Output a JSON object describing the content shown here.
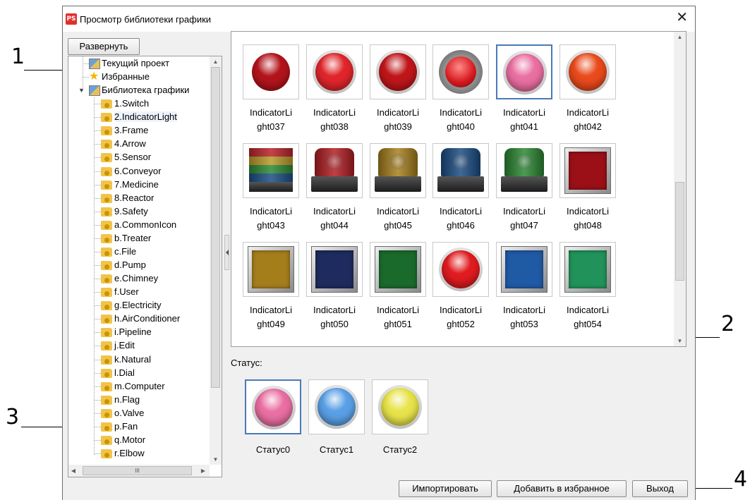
{
  "callouts": [
    "1",
    "2",
    "3",
    "4"
  ],
  "window": {
    "app_icon_text": "PS",
    "title": "Просмотр библиотеки графики",
    "close_glyph": "✕"
  },
  "toolbar": {
    "expand_label": "Развернуть"
  },
  "tree": {
    "root_items": [
      {
        "label": "Текущий проект",
        "icon": "project-icon"
      },
      {
        "label": "Избранные",
        "icon": "star-icon"
      },
      {
        "label": "Библиотека графики",
        "icon": "project-icon",
        "expanded": true
      }
    ],
    "library_items": [
      "1.Switch",
      "2.IndicatorLight",
      "3.Frame",
      "4.Arrow",
      "5.Sensor",
      "6.Conveyor",
      "7.Medicine",
      "8.Reactor",
      "9.Safety",
      "a.CommonIcon",
      "b.Treater",
      "c.File",
      "d.Pump",
      "e.Chimney",
      "f.User",
      "g.Electricity",
      "h.AirConditioner",
      "i.Pipeline",
      "j.Edit",
      "k.Natural",
      "l.Dial",
      "m.Computer",
      "n.Flag",
      "o.Valve",
      "p.Fan",
      "q.Motor",
      "r.Elbow"
    ],
    "selected_item": "2.IndicatorLight",
    "hscroll_thumb_glyph": "III"
  },
  "gallery": {
    "items": [
      {
        "line1": "IndicatorLi",
        "line2": "ght037",
        "kind": "button",
        "color": "#b3141c"
      },
      {
        "line1": "IndicatorLi",
        "line2": "ght038",
        "kind": "button-ring",
        "color": "#e0262b"
      },
      {
        "line1": "IndicatorLi",
        "line2": "ght039",
        "kind": "button-ring",
        "color": "#c0161a"
      },
      {
        "line1": "IndicatorLi",
        "line2": "ght040",
        "kind": "lamp",
        "color": "#d81c20"
      },
      {
        "line1": "IndicatorLi",
        "line2": "ght041",
        "kind": "button-ring",
        "color": "#ea6fa2",
        "selected": true
      },
      {
        "line1": "IndicatorLi",
        "line2": "ght042",
        "kind": "button-ring",
        "color": "#ea4a1c"
      },
      {
        "line1": "IndicatorLi",
        "line2": "ght043",
        "kind": "stack",
        "color": "#3a6ea8"
      },
      {
        "line1": "IndicatorLi",
        "line2": "ght044",
        "kind": "beacon",
        "color": "#b51f24"
      },
      {
        "line1": "IndicatorLi",
        "line2": "ght045",
        "kind": "beacon",
        "color": "#a9821e"
      },
      {
        "line1": "IndicatorLi",
        "line2": "ght046",
        "kind": "beacon",
        "color": "#1c4f86"
      },
      {
        "line1": "IndicatorLi",
        "line2": "ght047",
        "kind": "beacon",
        "color": "#2e8a34"
      },
      {
        "line1": "IndicatorLi",
        "line2": "ght048",
        "kind": "square",
        "color": "#9a1016"
      },
      {
        "line1": "IndicatorLi",
        "line2": "ght049",
        "kind": "square",
        "color": "#a57e1c"
      },
      {
        "line1": "IndicatorLi",
        "line2": "ght050",
        "kind": "square",
        "color": "#1d2b5e"
      },
      {
        "line1": "IndicatorLi",
        "line2": "ght051",
        "kind": "square",
        "color": "#1a6a2c"
      },
      {
        "line1": "IndicatorLi",
        "line2": "ght052",
        "kind": "button-ring",
        "color": "#e01c20"
      },
      {
        "line1": "IndicatorLi",
        "line2": "ght053",
        "kind": "square",
        "color": "#1f5aa5"
      },
      {
        "line1": "IndicatorLi",
        "line2": "ght054",
        "kind": "square",
        "color": "#21935a"
      }
    ]
  },
  "status": {
    "label": "Статус:",
    "items": [
      {
        "label": "Статус0",
        "color": "#ea6fa2",
        "selected": true
      },
      {
        "label": "Статус1",
        "color": "#5aa0e6"
      },
      {
        "label": "Статус2",
        "color": "#e8e34a"
      }
    ]
  },
  "footer": {
    "import_label": "Импортировать",
    "favorite_label": "Добавить в избранное",
    "exit_label": "Выход"
  }
}
